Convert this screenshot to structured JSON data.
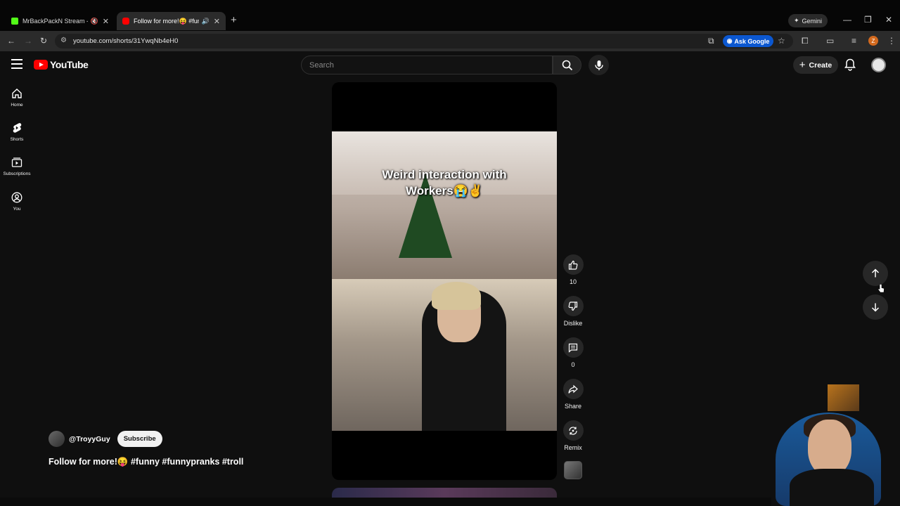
{
  "browser": {
    "tabs": [
      {
        "title": "MrBackPackN Stream - Wa",
        "favicon_color": "#53fc18",
        "audio": "muted-icon"
      },
      {
        "title": "Follow for more!😝 #funny",
        "favicon_color": "#ff0000",
        "audio": "speaker-icon"
      }
    ],
    "gemini_label": "Gemini",
    "url": "youtube.com/shorts/31YwqNb4eH0",
    "ask_google_label": "Ask Google",
    "profile_initial": "Z"
  },
  "youtube": {
    "logo_text": "YouTube",
    "search_placeholder": "Search",
    "create_label": "Create",
    "sidebar": [
      {
        "label": "Home",
        "icon": "home-icon"
      },
      {
        "label": "Shorts",
        "icon": "shorts-icon"
      },
      {
        "label": "Subscriptions",
        "icon": "subscriptions-icon"
      },
      {
        "label": "You",
        "icon": "you-icon"
      }
    ],
    "video": {
      "caption_line1": "Weird interaction with",
      "caption_line2": "Workers😭✌️"
    },
    "actions": {
      "like_count": "10",
      "dislike_label": "Dislike",
      "comment_count": "0",
      "share_label": "Share",
      "remix_label": "Remix"
    },
    "channel": {
      "name": "@TroyyGuy",
      "subscribe_label": "Subscribe"
    },
    "description": "Follow for more!😝 #funny #funnypranks #troll"
  },
  "colors": {
    "background": "#0f0f0f",
    "accent_red": "#ff0000",
    "ask_google_blue": "#0b57d0"
  }
}
